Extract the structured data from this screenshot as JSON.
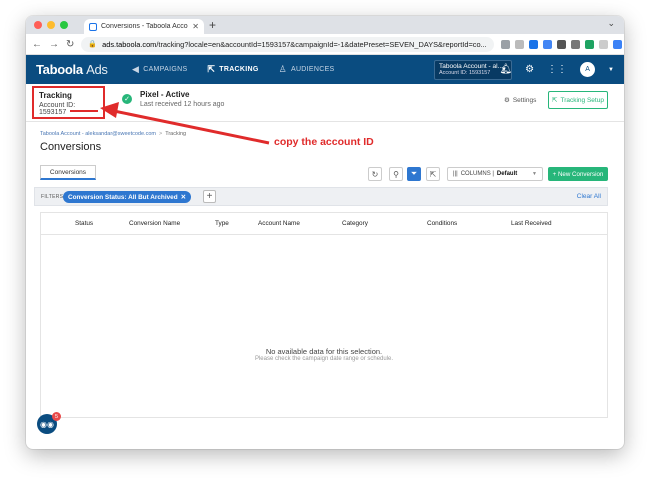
{
  "colors": {
    "brand_navy": "#0a4c80",
    "accent_blue": "#2e77d0",
    "success_green": "#27b67a",
    "annotation_red": "#e02b2b"
  },
  "browser": {
    "tab_title": "Conversions - Taboola Accoun",
    "url_host": "ads.taboola.com",
    "url_path": "/tracking?locale=en&accountId=1593157&campaignId=-1&datePreset=SEVEN_DAYS&reportId=co..."
  },
  "topnav": {
    "logo": "Taboola",
    "logo_suffix": "Ads",
    "items": [
      {
        "label": "CAMPAIGNS",
        "icon": "megaphone-icon"
      },
      {
        "label": "TRACKING",
        "icon": "tracking-icon"
      },
      {
        "label": "AUDIENCES",
        "icon": "person-icon"
      }
    ],
    "account_name": "Taboola Account - al...",
    "account_id": "Account ID: 1593157",
    "avatar": "A"
  },
  "pixel_header": {
    "title": "Tracking",
    "account_id": "Account ID: 1593157",
    "status": "Pixel - Active",
    "last_received": "Last received 12 hours ago",
    "settings_label": "Settings",
    "setup_label": "Tracking Setup"
  },
  "breadcrumb": {
    "account": "Taboola Account - aleksandar@sweetcode.com",
    "current": "Tracking"
  },
  "page_title": "Conversions",
  "annotation": "copy the account ID",
  "toolbar": {
    "tab_label": "Conversions",
    "columns_prefix": "COLUMNS |",
    "columns_value": "Default",
    "new_conversion": "+ New Conversion"
  },
  "filters": {
    "label": "FILTERS",
    "chip": "Conversion Status: All But Archived",
    "clear_all": "Clear All"
  },
  "table": {
    "columns": [
      "Status",
      "Conversion Name",
      "Type",
      "Account Name",
      "Category",
      "Conditions",
      "Last Received"
    ],
    "empty_title": "No available data for this selection.",
    "empty_subtitle": "Please check the campaign date range or schedule."
  },
  "chat_badge": "5"
}
